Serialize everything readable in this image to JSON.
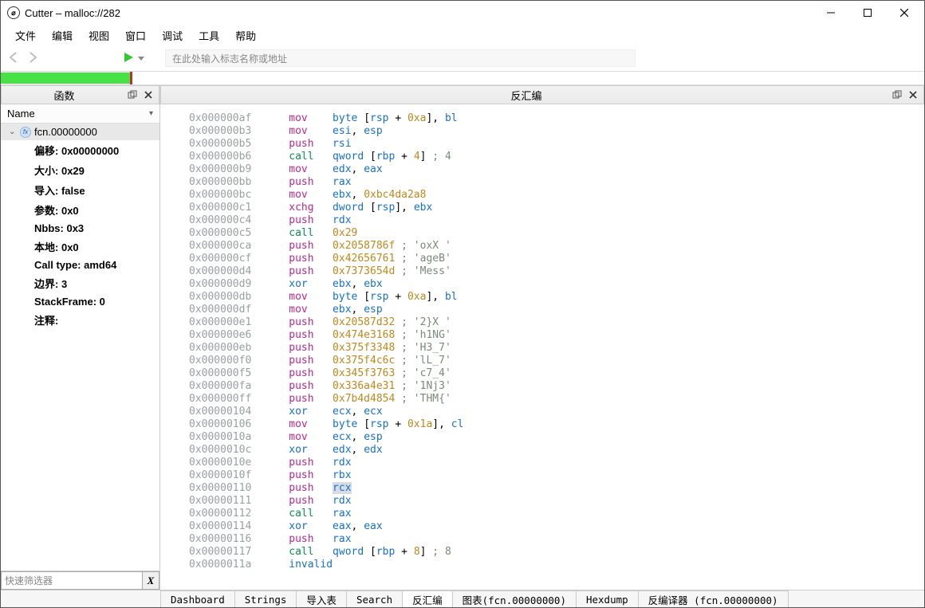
{
  "title": "Cutter – malloc://282",
  "menu": [
    "文件",
    "编辑",
    "视图",
    "窗口",
    "调试",
    "工具",
    "帮助"
  ],
  "toolbar": {
    "addr_placeholder": "在此处输入标志名称或地址"
  },
  "navstrip": {
    "segments": [
      [
        0,
        14
      ]
    ],
    "ticks": [
      14
    ]
  },
  "leftpanel": {
    "title": "函数",
    "column": "Name",
    "filter_placeholder": "快速筛选器",
    "fn_name": "fcn.00000000",
    "props": [
      {
        "k": "偏移:",
        "v": "0x00000000"
      },
      {
        "k": "大小:",
        "v": "0x29"
      },
      {
        "k": "导入:",
        "v": "false"
      },
      {
        "k": "参数:",
        "v": "0x0"
      },
      {
        "k": "Nbbs:",
        "v": "0x3"
      },
      {
        "k": "本地:",
        "v": "0x0"
      },
      {
        "k": "Call type:",
        "v": "amd64"
      },
      {
        "k": "边界:",
        "v": "3"
      },
      {
        "k": "StackFrame:",
        "v": "0"
      },
      {
        "k": "注释:",
        "v": ""
      }
    ]
  },
  "rightpanel": {
    "title": "反汇编"
  },
  "disasm": [
    {
      "addr": "0x000000af",
      "mnem": "mov",
      "mcls": "mnem-mov",
      "ops": [
        {
          "t": "kw",
          "v": "byte "
        },
        {
          "t": "txt",
          "v": "["
        },
        {
          "t": "reg",
          "v": "rsp"
        },
        {
          "t": "txt",
          "v": " + "
        },
        {
          "t": "num",
          "v": "0xa"
        },
        {
          "t": "txt",
          "v": "], "
        },
        {
          "t": "reg",
          "v": "bl"
        }
      ]
    },
    {
      "addr": "0x000000b3",
      "mnem": "mov",
      "mcls": "mnem-mov",
      "ops": [
        {
          "t": "reg",
          "v": "esi"
        },
        {
          "t": "txt",
          "v": ", "
        },
        {
          "t": "reg",
          "v": "esp"
        }
      ]
    },
    {
      "addr": "0x000000b5",
      "mnem": "push",
      "mcls": "mnem-push",
      "ops": [
        {
          "t": "reg",
          "v": "rsi"
        }
      ]
    },
    {
      "addr": "0x000000b6",
      "mnem": "call",
      "mcls": "mnem-call",
      "ops": [
        {
          "t": "kw",
          "v": "qword "
        },
        {
          "t": "txt",
          "v": "["
        },
        {
          "t": "reg",
          "v": "rbp"
        },
        {
          "t": "txt",
          "v": " + "
        },
        {
          "t": "num",
          "v": "4"
        },
        {
          "t": "txt",
          "v": "]"
        }
      ],
      "cmt": " ; 4"
    },
    {
      "addr": "0x000000b9",
      "mnem": "mov",
      "mcls": "mnem-mov",
      "ops": [
        {
          "t": "reg",
          "v": "edx"
        },
        {
          "t": "txt",
          "v": ", "
        },
        {
          "t": "reg",
          "v": "eax"
        }
      ]
    },
    {
      "addr": "0x000000bb",
      "mnem": "push",
      "mcls": "mnem-push",
      "ops": [
        {
          "t": "reg",
          "v": "rax"
        }
      ]
    },
    {
      "addr": "0x000000bc",
      "mnem": "mov",
      "mcls": "mnem-mov",
      "ops": [
        {
          "t": "reg",
          "v": "ebx"
        },
        {
          "t": "txt",
          "v": ", "
        },
        {
          "t": "num",
          "v": "0xbc4da2a8"
        }
      ]
    },
    {
      "addr": "0x000000c1",
      "mnem": "xchg",
      "mcls": "mnem-xchg",
      "ops": [
        {
          "t": "kw",
          "v": "dword "
        },
        {
          "t": "txt",
          "v": "["
        },
        {
          "t": "reg",
          "v": "rsp"
        },
        {
          "t": "txt",
          "v": "], "
        },
        {
          "t": "reg",
          "v": "ebx"
        }
      ]
    },
    {
      "addr": "0x000000c4",
      "mnem": "push",
      "mcls": "mnem-push",
      "ops": [
        {
          "t": "reg",
          "v": "rdx"
        }
      ]
    },
    {
      "addr": "0x000000c5",
      "mnem": "call",
      "mcls": "mnem-call",
      "ops": [
        {
          "t": "num",
          "v": "0x29"
        }
      ]
    },
    {
      "addr": "0x000000ca",
      "mnem": "push",
      "mcls": "mnem-push",
      "ops": [
        {
          "t": "num",
          "v": "0x2058786f"
        }
      ],
      "cmt": " ; 'oxX '"
    },
    {
      "addr": "0x000000cf",
      "mnem": "push",
      "mcls": "mnem-push",
      "ops": [
        {
          "t": "num",
          "v": "0x42656761"
        }
      ],
      "cmt": " ; 'ageB'"
    },
    {
      "addr": "0x000000d4",
      "mnem": "push",
      "mcls": "mnem-push",
      "ops": [
        {
          "t": "num",
          "v": "0x7373654d"
        }
      ],
      "cmt": " ; 'Mess'"
    },
    {
      "addr": "0x000000d9",
      "mnem": "xor",
      "mcls": "mnem-xor",
      "ops": [
        {
          "t": "reg",
          "v": "ebx"
        },
        {
          "t": "txt",
          "v": ", "
        },
        {
          "t": "reg",
          "v": "ebx"
        }
      ]
    },
    {
      "addr": "0x000000db",
      "mnem": "mov",
      "mcls": "mnem-mov",
      "ops": [
        {
          "t": "kw",
          "v": "byte "
        },
        {
          "t": "txt",
          "v": "["
        },
        {
          "t": "reg",
          "v": "rsp"
        },
        {
          "t": "txt",
          "v": " + "
        },
        {
          "t": "num",
          "v": "0xa"
        },
        {
          "t": "txt",
          "v": "], "
        },
        {
          "t": "reg",
          "v": "bl"
        }
      ]
    },
    {
      "addr": "0x000000df",
      "mnem": "mov",
      "mcls": "mnem-mov",
      "ops": [
        {
          "t": "reg",
          "v": "ebx"
        },
        {
          "t": "txt",
          "v": ", "
        },
        {
          "t": "reg",
          "v": "esp"
        }
      ]
    },
    {
      "addr": "0x000000e1",
      "mnem": "push",
      "mcls": "mnem-push",
      "ops": [
        {
          "t": "num",
          "v": "0x20587d32"
        }
      ],
      "cmt": " ; '2}X '"
    },
    {
      "addr": "0x000000e6",
      "mnem": "push",
      "mcls": "mnem-push",
      "ops": [
        {
          "t": "num",
          "v": "0x474e3168"
        }
      ],
      "cmt": " ; 'h1NG'"
    },
    {
      "addr": "0x000000eb",
      "mnem": "push",
      "mcls": "mnem-push",
      "ops": [
        {
          "t": "num",
          "v": "0x375f3348"
        }
      ],
      "cmt": " ; 'H3_7'"
    },
    {
      "addr": "0x000000f0",
      "mnem": "push",
      "mcls": "mnem-push",
      "ops": [
        {
          "t": "num",
          "v": "0x375f4c6c"
        }
      ],
      "cmt": " ; 'lL_7'"
    },
    {
      "addr": "0x000000f5",
      "mnem": "push",
      "mcls": "mnem-push",
      "ops": [
        {
          "t": "num",
          "v": "0x345f3763"
        }
      ],
      "cmt": " ; 'c7_4'"
    },
    {
      "addr": "0x000000fa",
      "mnem": "push",
      "mcls": "mnem-push",
      "ops": [
        {
          "t": "num",
          "v": "0x336a4e31"
        }
      ],
      "cmt": " ; '1Nj3'"
    },
    {
      "addr": "0x000000ff",
      "mnem": "push",
      "mcls": "mnem-push",
      "ops": [
        {
          "t": "num",
          "v": "0x7b4d4854"
        }
      ],
      "cmt": " ; 'THM{'"
    },
    {
      "addr": "0x00000104",
      "mnem": "xor",
      "mcls": "mnem-xor",
      "ops": [
        {
          "t": "reg",
          "v": "ecx"
        },
        {
          "t": "txt",
          "v": ", "
        },
        {
          "t": "reg",
          "v": "ecx"
        }
      ]
    },
    {
      "addr": "0x00000106",
      "mnem": "mov",
      "mcls": "mnem-mov",
      "ops": [
        {
          "t": "kw",
          "v": "byte "
        },
        {
          "t": "txt",
          "v": "["
        },
        {
          "t": "reg",
          "v": "rsp"
        },
        {
          "t": "txt",
          "v": " + "
        },
        {
          "t": "num",
          "v": "0x1a"
        },
        {
          "t": "txt",
          "v": "], "
        },
        {
          "t": "reg",
          "v": "cl"
        }
      ]
    },
    {
      "addr": "0x0000010a",
      "mnem": "mov",
      "mcls": "mnem-mov",
      "ops": [
        {
          "t": "reg",
          "v": "ecx"
        },
        {
          "t": "txt",
          "v": ", "
        },
        {
          "t": "reg",
          "v": "esp"
        }
      ]
    },
    {
      "addr": "0x0000010c",
      "mnem": "xor",
      "mcls": "mnem-xor",
      "ops": [
        {
          "t": "reg",
          "v": "edx"
        },
        {
          "t": "txt",
          "v": ", "
        },
        {
          "t": "reg",
          "v": "edx"
        }
      ]
    },
    {
      "addr": "0x0000010e",
      "mnem": "push",
      "mcls": "mnem-push",
      "ops": [
        {
          "t": "reg",
          "v": "rdx"
        }
      ]
    },
    {
      "addr": "0x0000010f",
      "mnem": "push",
      "mcls": "mnem-push",
      "ops": [
        {
          "t": "reg",
          "v": "rbx"
        }
      ]
    },
    {
      "addr": "0x00000110",
      "mnem": "push",
      "mcls": "mnem-push",
      "ops": [
        {
          "t": "reg",
          "v": "rcx",
          "hl": true
        }
      ]
    },
    {
      "addr": "0x00000111",
      "mnem": "push",
      "mcls": "mnem-push",
      "ops": [
        {
          "t": "reg",
          "v": "rdx"
        }
      ]
    },
    {
      "addr": "0x00000112",
      "mnem": "call",
      "mcls": "mnem-call",
      "ops": [
        {
          "t": "reg",
          "v": "rax"
        }
      ]
    },
    {
      "addr": "0x00000114",
      "mnem": "xor",
      "mcls": "mnem-xor",
      "ops": [
        {
          "t": "reg",
          "v": "eax"
        },
        {
          "t": "txt",
          "v": ", "
        },
        {
          "t": "reg",
          "v": "eax"
        }
      ]
    },
    {
      "addr": "0x00000116",
      "mnem": "push",
      "mcls": "mnem-push",
      "ops": [
        {
          "t": "reg",
          "v": "rax"
        }
      ]
    },
    {
      "addr": "0x00000117",
      "mnem": "call",
      "mcls": "mnem-call",
      "ops": [
        {
          "t": "kw",
          "v": "qword "
        },
        {
          "t": "txt",
          "v": "["
        },
        {
          "t": "reg",
          "v": "rbp"
        },
        {
          "t": "txt",
          "v": " + "
        },
        {
          "t": "num",
          "v": "8"
        },
        {
          "t": "txt",
          "v": "]"
        }
      ],
      "cmt": " ; 8"
    },
    {
      "addr": "0x0000011a",
      "mnem": "invalid",
      "mcls": "mnem-inv",
      "ops": []
    }
  ],
  "bottomtabs": [
    "Dashboard",
    "Strings",
    "导入表",
    "Search",
    "反汇编",
    "图表(fcn.00000000)",
    "Hexdump",
    "反编译器 (fcn.00000000)"
  ],
  "bottomtab_active": 4
}
